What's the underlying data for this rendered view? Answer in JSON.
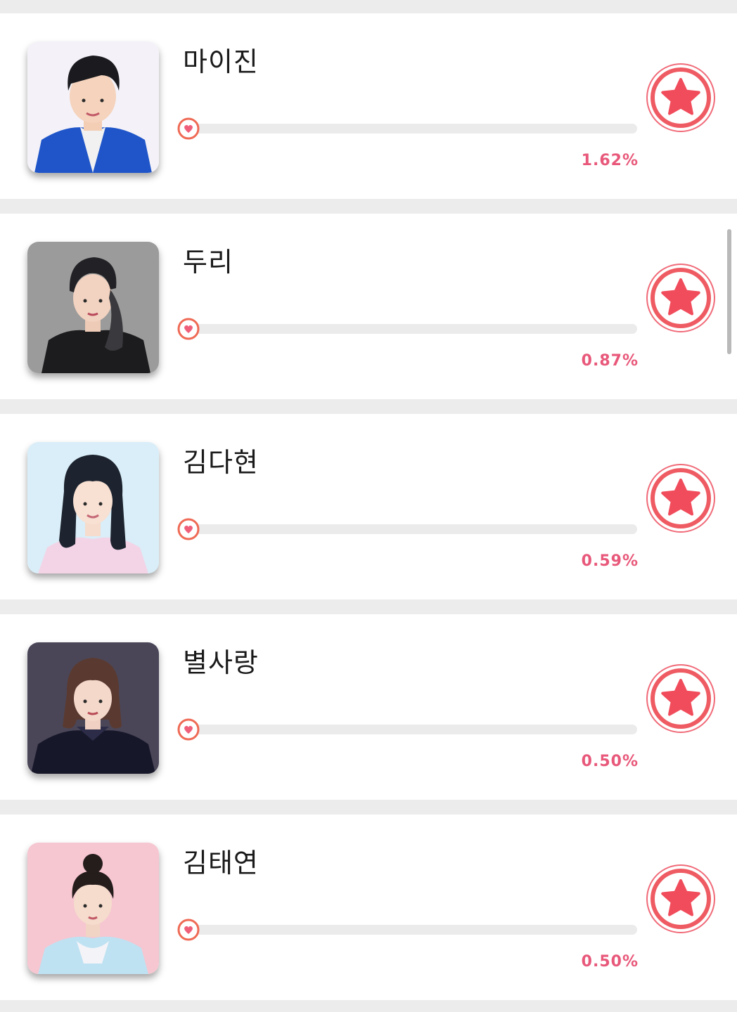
{
  "colors": {
    "accent": "#f0566b",
    "percent_text": "#e8587a",
    "track": "#ebebeb",
    "separator": "#ececec"
  },
  "icons": {
    "knob": "heart-icon",
    "vote": "star-icon"
  },
  "candidates": [
    {
      "name": "마이진",
      "percent_label": "1.62%",
      "percent_value": 1.62
    },
    {
      "name": "두리",
      "percent_label": "0.87%",
      "percent_value": 0.87
    },
    {
      "name": "김다현",
      "percent_label": "0.59%",
      "percent_value": 0.59
    },
    {
      "name": "별사랑",
      "percent_label": "0.50%",
      "percent_value": 0.5
    },
    {
      "name": "김태연",
      "percent_label": "0.50%",
      "percent_value": 0.5
    }
  ]
}
